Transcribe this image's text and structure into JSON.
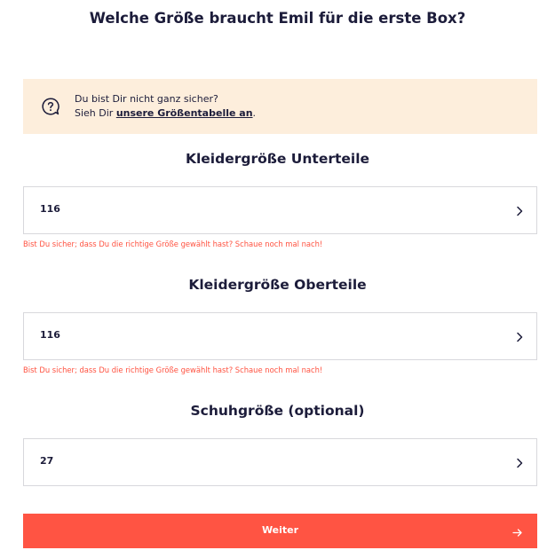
{
  "title": "Welche Größe braucht Emil für die erste Box?",
  "hint": {
    "line1": "Du bist Dir nicht ganz sicher?",
    "line2_prefix": "Sieh Dir ",
    "link_label": "unsere Größentabelle an",
    "line2_suffix": ".",
    "icon": "question-bubble-icon"
  },
  "sections": {
    "bottoms": {
      "heading": "Kleidergröße Unterteile",
      "value": "116",
      "error": "Bist Du sicher; dass Du die richtige Größe gewählt hast? Schaue noch mal nach!"
    },
    "tops": {
      "heading": "Kleidergröße Oberteile",
      "value": "116",
      "error": "Bist Du sicher; dass Du die richtige Größe gewählt hast? Schaue noch mal nach!"
    },
    "shoes": {
      "heading": "Schuhgröße (optional)",
      "value": "27"
    }
  },
  "next_button": {
    "label": "Weiter",
    "icon": "arrow-right-icon"
  },
  "colors": {
    "text": "#1c1c3a",
    "hint_background": "#fdeedc",
    "error": "#ff5240",
    "primary_button": "#ff5443",
    "field_border": "#d8d8dc"
  }
}
